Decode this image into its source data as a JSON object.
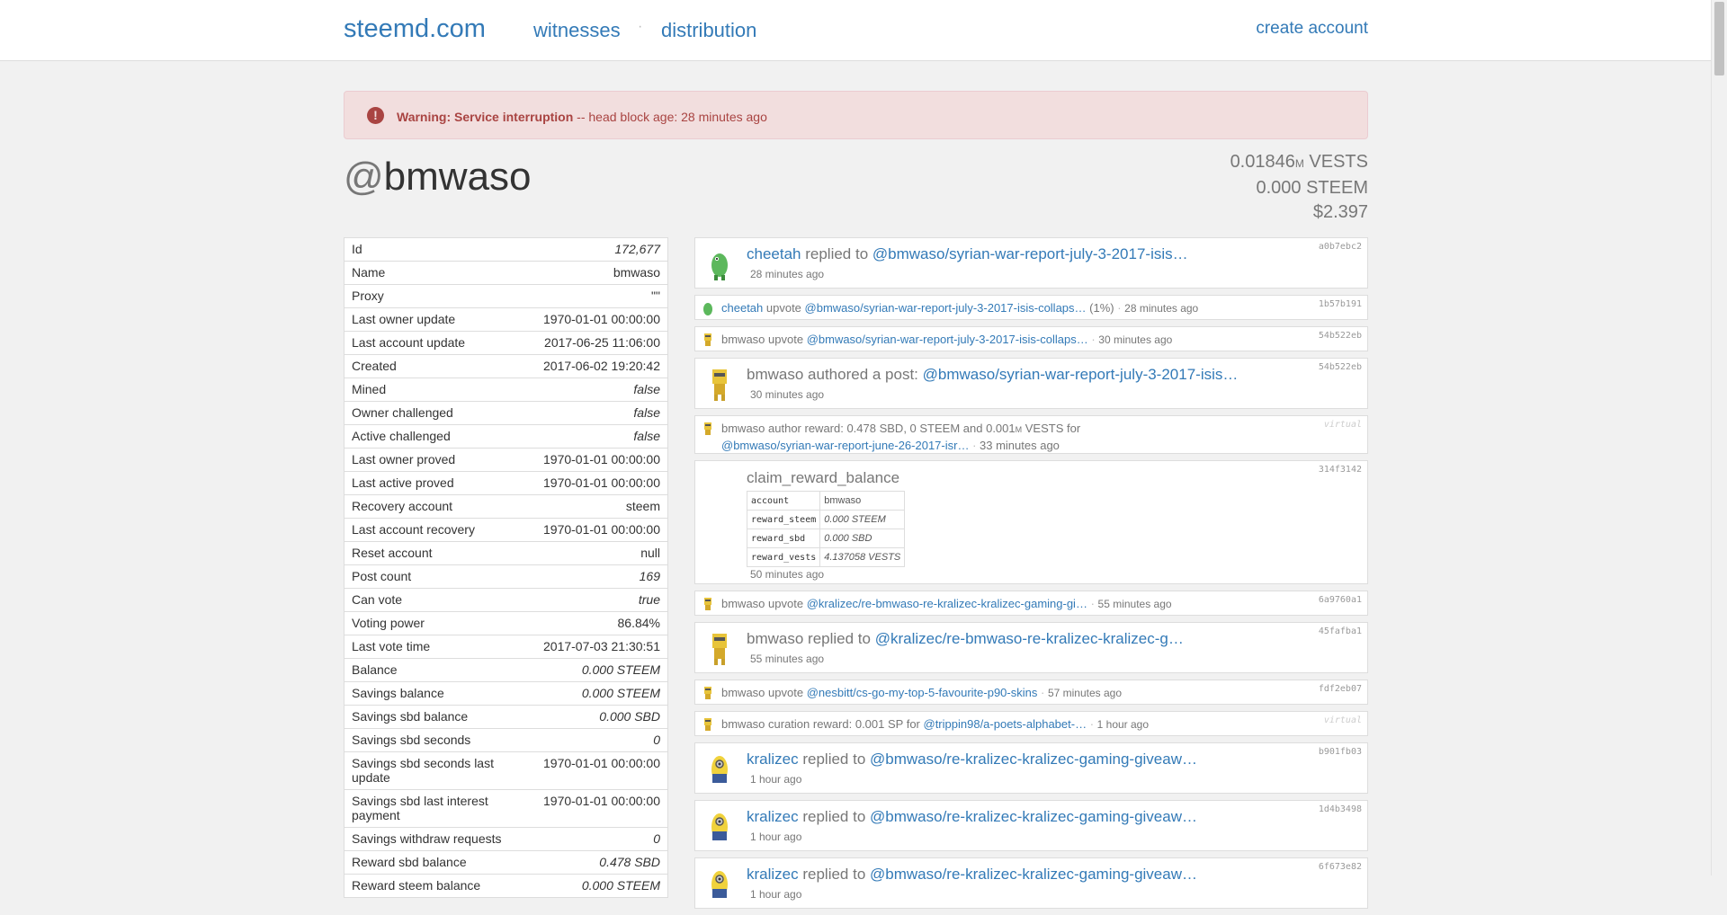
{
  "nav": {
    "brand": "steemd.com",
    "witnesses": "witnesses",
    "dot": "·",
    "distribution": "distribution",
    "create_account": "create account"
  },
  "alert": {
    "title": "Warning: Service interruption",
    "message": " -- head block age: 28 minutes ago"
  },
  "account": {
    "at": "@",
    "name": "bmwaso"
  },
  "stats": {
    "vests_value": "0.01846",
    "vests_m": "M",
    "vests_unit": " VESTS",
    "steem": "0.000 STEEM",
    "usd": "$2.397"
  },
  "props": [
    {
      "k": "Id",
      "v": "172,677",
      "italic": true
    },
    {
      "k": "Name",
      "v": "bmwaso",
      "italic": false
    },
    {
      "k": "Proxy",
      "v": "\"\"",
      "italic": false
    },
    {
      "k": "Last owner update",
      "v": "1970-01-01 00:00:00",
      "italic": false
    },
    {
      "k": "Last account update",
      "v": "2017-06-25 11:06:00",
      "italic": false
    },
    {
      "k": "Created",
      "v": "2017-06-02 19:20:42",
      "italic": false
    },
    {
      "k": "Mined",
      "v": "false",
      "italic": true
    },
    {
      "k": "Owner challenged",
      "v": "false",
      "italic": true
    },
    {
      "k": "Active challenged",
      "v": "false",
      "italic": true
    },
    {
      "k": "Last owner proved",
      "v": "1970-01-01 00:00:00",
      "italic": false
    },
    {
      "k": "Last active proved",
      "v": "1970-01-01 00:00:00",
      "italic": false
    },
    {
      "k": "Recovery account",
      "v": "steem",
      "italic": false
    },
    {
      "k": "Last account recovery",
      "v": "1970-01-01 00:00:00",
      "italic": false
    },
    {
      "k": "Reset account",
      "v": "null",
      "italic": false
    },
    {
      "k": "Post count",
      "v": "169",
      "italic": true
    },
    {
      "k": "Can vote",
      "v": "true",
      "italic": true
    },
    {
      "k": "Voting power",
      "v": "86.84%",
      "italic": false
    },
    {
      "k": "Last vote time",
      "v": "2017-07-03 21:30:51",
      "italic": false
    },
    {
      "k": "Balance",
      "v": "0.000 STEEM",
      "italic": true
    },
    {
      "k": "Savings balance",
      "v": "0.000 STEEM",
      "italic": true
    },
    {
      "k": "Savings sbd balance",
      "v": "0.000 SBD",
      "italic": true
    },
    {
      "k": "Savings sbd seconds",
      "v": "0",
      "italic": true
    },
    {
      "k": "Savings sbd seconds last update",
      "v": "1970-01-01 00:00:00",
      "italic": false
    },
    {
      "k": "Savings sbd last interest payment",
      "v": "1970-01-01 00:00:00",
      "italic": false
    },
    {
      "k": "Savings withdraw requests",
      "v": "0",
      "italic": true
    },
    {
      "k": "Reward sbd balance",
      "v": "0.478 SBD",
      "italic": true
    },
    {
      "k": "Reward steem balance",
      "v": "0.000 STEEM",
      "italic": true
    }
  ],
  "feed": {
    "op1": {
      "user": "cheetah",
      "action": " replied to ",
      "link": "@bmwaso/syrian-war-report-july-3-2017-isis…",
      "time": "28 minutes ago",
      "hash": "a0b7ebc2"
    },
    "op2": {
      "user": "cheetah",
      "action": " upvote ",
      "link": "@bmwaso/syrian-war-report-july-3-2017-isis-collaps…",
      "extra": " (1%)",
      "dot": " · ",
      "time": "28 minutes ago",
      "hash": "1b57b191"
    },
    "op3": {
      "user": "bmwaso",
      "action": " upvote ",
      "link": "@bmwaso/syrian-war-report-july-3-2017-isis-collaps…",
      "dot": " · ",
      "time": "30 minutes ago",
      "hash": "54b522eb"
    },
    "op4": {
      "user": "bmwaso",
      "action": " authored a post: ",
      "link": "@bmwaso/syrian-war-report-july-3-2017-isis…",
      "time": "30 minutes ago",
      "hash": "54b522eb"
    },
    "op5": {
      "text": "bmwaso author reward: 0.478 SBD, 0 STEEM and 0.001",
      "m": "M",
      "text2": " VESTS for",
      "link": "@bmwaso/syrian-war-report-june-26-2017-isr…",
      "dot": " · ",
      "time": "33 minutes ago",
      "hash": "virtual"
    },
    "op6": {
      "title": "claim_reward_balance",
      "rows": [
        {
          "k": "account",
          "v": "bmwaso"
        },
        {
          "k": "reward_steem",
          "v": "0.000 STEEM"
        },
        {
          "k": "reward_sbd",
          "v": "0.000 SBD"
        },
        {
          "k": "reward_vests",
          "v": "4.137058 VESTS"
        }
      ],
      "time": "50 minutes ago",
      "hash": "314f3142"
    },
    "op7": {
      "user": "bmwaso",
      "action": " upvote ",
      "link": "@kralizec/re-bmwaso-re-kralizec-kralizec-gaming-gi…",
      "dot": " · ",
      "time": "55 minutes ago",
      "hash": "6a9760a1"
    },
    "op8": {
      "user": "bmwaso",
      "action": " replied to ",
      "link": "@kralizec/re-bmwaso-re-kralizec-kralizec-g…",
      "time": "55 minutes ago",
      "hash": "45fafba1"
    },
    "op9": {
      "user": "bmwaso",
      "action": " upvote ",
      "link": "@nesbitt/cs-go-my-top-5-favourite-p90-skins",
      "dot": " · ",
      "time": "57 minutes ago",
      "hash": "fdf2eb07"
    },
    "op10": {
      "text": "bmwaso curation reward: 0.001 SP for ",
      "link": "@trippin98/a-poets-alphabet-…",
      "dot": " · ",
      "time": "1 hour ago",
      "hash": "virtual"
    },
    "op11": {
      "user": "kralizec",
      "action": " replied to ",
      "link": "@bmwaso/re-kralizec-kralizec-gaming-giveaw…",
      "time": "1 hour ago",
      "hash": "b901fb03"
    },
    "op12": {
      "user": "kralizec",
      "action": " replied to ",
      "link": "@bmwaso/re-kralizec-kralizec-gaming-giveaw…",
      "time": "1 hour ago",
      "hash": "1d4b3498"
    },
    "op13": {
      "user": "kralizec",
      "action": " replied to ",
      "link": "@bmwaso/re-kralizec-kralizec-gaming-giveaw…",
      "time": "1 hour ago",
      "hash": "6f673e82"
    }
  },
  "colors": {
    "link": "#337ab7",
    "alert_bg": "#f2dede",
    "alert_text": "#a94442"
  },
  "icons": {
    "alert": "exclamation-circle-icon",
    "avatar_bmwaso": "yellow-robot-avatar",
    "avatar_cheetah": "green-cheetah-avatar",
    "avatar_kralizec": "yellow-minion-avatar"
  }
}
